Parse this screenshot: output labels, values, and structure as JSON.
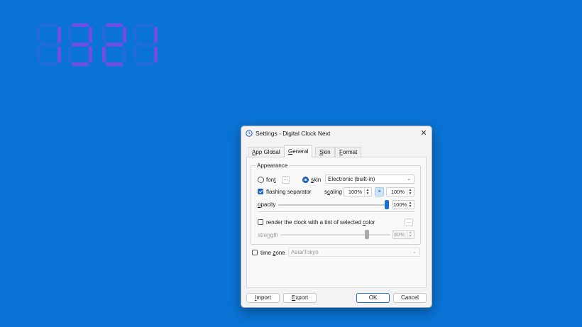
{
  "clock": {
    "time_text": "1321",
    "color": "#7a49e6",
    "dim_color": "#4d5fd8"
  },
  "dialog": {
    "title": "Settings - Digital Clock Next",
    "close_glyph": "✕",
    "tabs": [
      "App Global",
      "General",
      "Skin",
      "Format"
    ],
    "active_tab": "General",
    "appearance": {
      "group_title": "Appearance",
      "font_label": "font",
      "font_button": "...",
      "skin_label": "skin",
      "skin_value": "Electronic (built-in)",
      "flashing_separator_label": "flashing separator",
      "flashing_separator_checked": true,
      "scaling_label": "scaling",
      "scaling_x": "100%",
      "scaling_y": "100%",
      "lock_glyph": "≡",
      "opacity_label": "opacity",
      "opacity_value": "100%",
      "opacity_fraction": 1.0,
      "tint_label": "render the clock with a tint of selected color",
      "tint_checked": false,
      "tint_button": "...",
      "strength_label": "strength",
      "strength_value": "80%",
      "strength_fraction": 0.8
    },
    "time_zone_label": "time zone",
    "time_zone_checked": false,
    "time_zone_value": "Asia/Tokyo",
    "buttons": {
      "import": "Import",
      "export": "Export",
      "ok": "OK",
      "cancel": "Cancel"
    }
  },
  "icons": {
    "settings": "clock-icon",
    "close": "close-icon",
    "dropdown": "chevron-down-icon"
  },
  "colors": {
    "desktop": "#0a74d6",
    "accent": "#1f5fbf"
  }
}
